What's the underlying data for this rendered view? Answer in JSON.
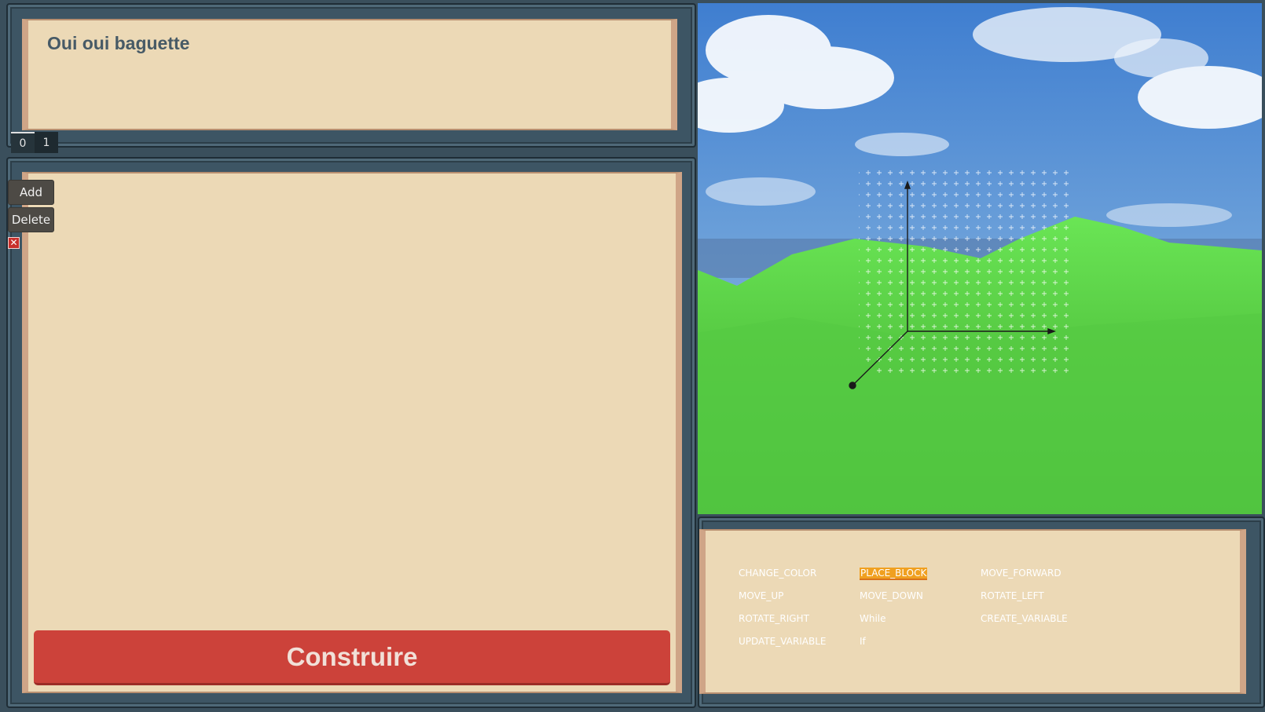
{
  "title_panel": {
    "text": "Oui oui baguette"
  },
  "tabs": [
    {
      "label": "0",
      "active": true
    },
    {
      "label": "1",
      "active": false
    }
  ],
  "side_buttons": {
    "add": "Add",
    "delete": "Delete",
    "close_icon": "close-icon"
  },
  "build_button": {
    "label": "Construire",
    "color": "#cc423a"
  },
  "commands": [
    {
      "label": "CHANGE_COLOR"
    },
    {
      "label": "PLACE_BLOCK",
      "selected": true
    },
    {
      "label": "MOVE_FORWARD"
    },
    {
      "label": "MOVE_UP"
    },
    {
      "label": "MOVE_DOWN"
    },
    {
      "label": "ROTATE_LEFT"
    },
    {
      "label": "ROTATE_RIGHT"
    },
    {
      "label": "While"
    },
    {
      "label": "CREATE_VARIABLE"
    },
    {
      "label": "UPDATE_VARIABLE"
    },
    {
      "label": "If"
    }
  ],
  "colors": {
    "frame": "#3d5564",
    "paper": "#ecd9b6",
    "terrain": "#5fd84a",
    "sky": "#5a92d4",
    "highlight": "#f0a020"
  }
}
